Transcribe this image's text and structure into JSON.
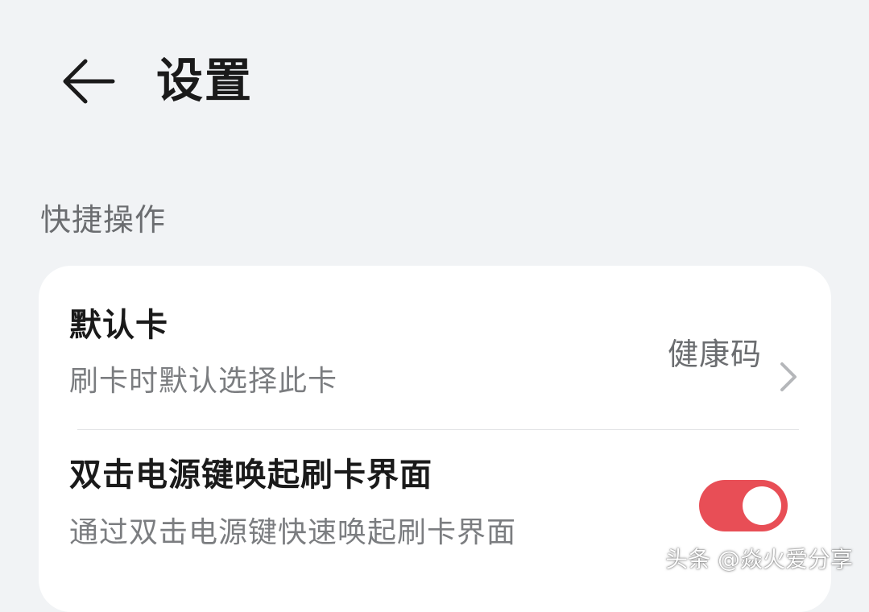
{
  "header": {
    "back_icon": "arrow-left-icon",
    "title": "设置"
  },
  "section": {
    "title": "快捷操作"
  },
  "settings": {
    "default_card": {
      "title": "默认卡",
      "subtitle": "刷卡时默认选择此卡",
      "value": "健康码",
      "icon": "chevron-right-icon"
    },
    "double_click": {
      "title": "双击电源键唤起刷卡界面",
      "subtitle": "通过双击电源键快速唤起刷卡界面",
      "toggle_on": true
    }
  },
  "watermark": {
    "text": "头条 @焱火爱分享"
  },
  "colors": {
    "background": "#f1f3f5",
    "card": "#ffffff",
    "toggle_on": "#e84e56",
    "text_primary": "#1a1a1a",
    "text_secondary": "#7b7d80"
  }
}
